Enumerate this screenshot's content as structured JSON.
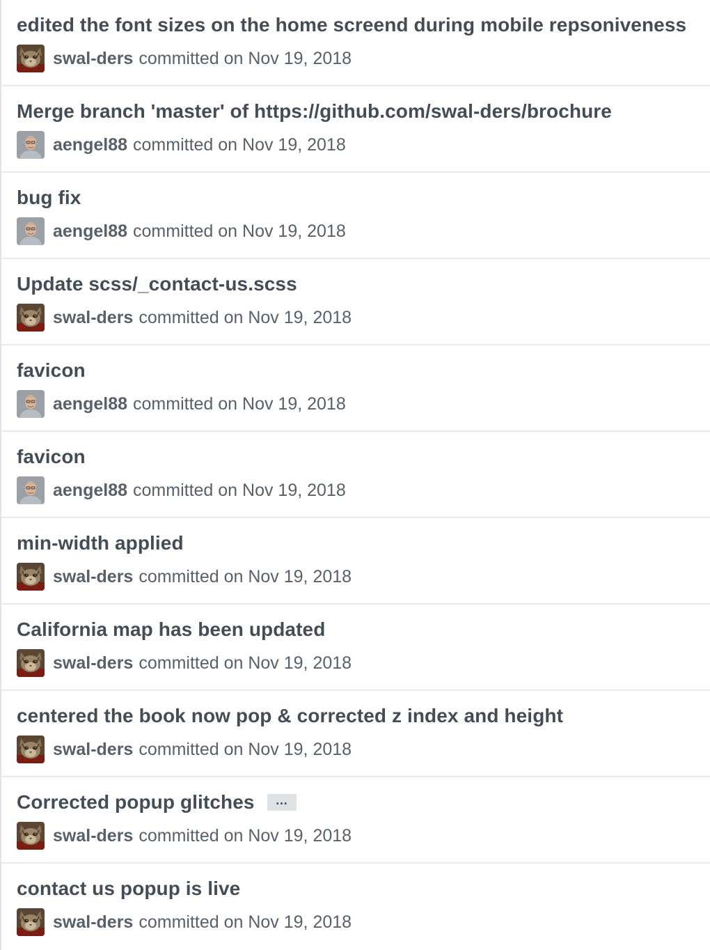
{
  "commits": [
    {
      "title": "edited the font sizes on the home screend during mobile repsoniveness",
      "author": "swal-ders",
      "avatar": "cat-avatar",
      "meta": "committed on Nov 19, 2018",
      "has_more": false
    },
    {
      "title": "Merge branch 'master' of https://github.com/swal-ders/brochure",
      "author": "aengel88",
      "avatar": "person-avatar",
      "meta": "committed on Nov 19, 2018",
      "has_more": false
    },
    {
      "title": "bug fix",
      "author": "aengel88",
      "avatar": "person-avatar",
      "meta": "committed on Nov 19, 2018",
      "has_more": false
    },
    {
      "title": "Update scss/_contact-us.scss",
      "author": "swal-ders",
      "avatar": "cat-avatar",
      "meta": "committed on Nov 19, 2018",
      "has_more": false
    },
    {
      "title": "favicon",
      "author": "aengel88",
      "avatar": "person-avatar",
      "meta": "committed on Nov 19, 2018",
      "has_more": false
    },
    {
      "title": "favicon",
      "author": "aengel88",
      "avatar": "person-avatar",
      "meta": "committed on Nov 19, 2018",
      "has_more": false
    },
    {
      "title": "min-width applied",
      "author": "swal-ders",
      "avatar": "cat-avatar",
      "meta": "committed on Nov 19, 2018",
      "has_more": false
    },
    {
      "title": "California map has been updated",
      "author": "swal-ders",
      "avatar": "cat-avatar",
      "meta": "committed on Nov 19, 2018",
      "has_more": false
    },
    {
      "title": "centered the book now pop & corrected z index and height",
      "author": "swal-ders",
      "avatar": "cat-avatar",
      "meta": "committed on Nov 19, 2018",
      "has_more": false
    },
    {
      "title": "Corrected popup glitches",
      "author": "swal-ders",
      "avatar": "cat-avatar",
      "meta": "committed on Nov 19, 2018",
      "has_more": true,
      "more_label": "…"
    },
    {
      "title": "contact us popup is live",
      "author": "swal-ders",
      "avatar": "cat-avatar",
      "meta": "committed on Nov 19, 2018",
      "has_more": false
    }
  ]
}
